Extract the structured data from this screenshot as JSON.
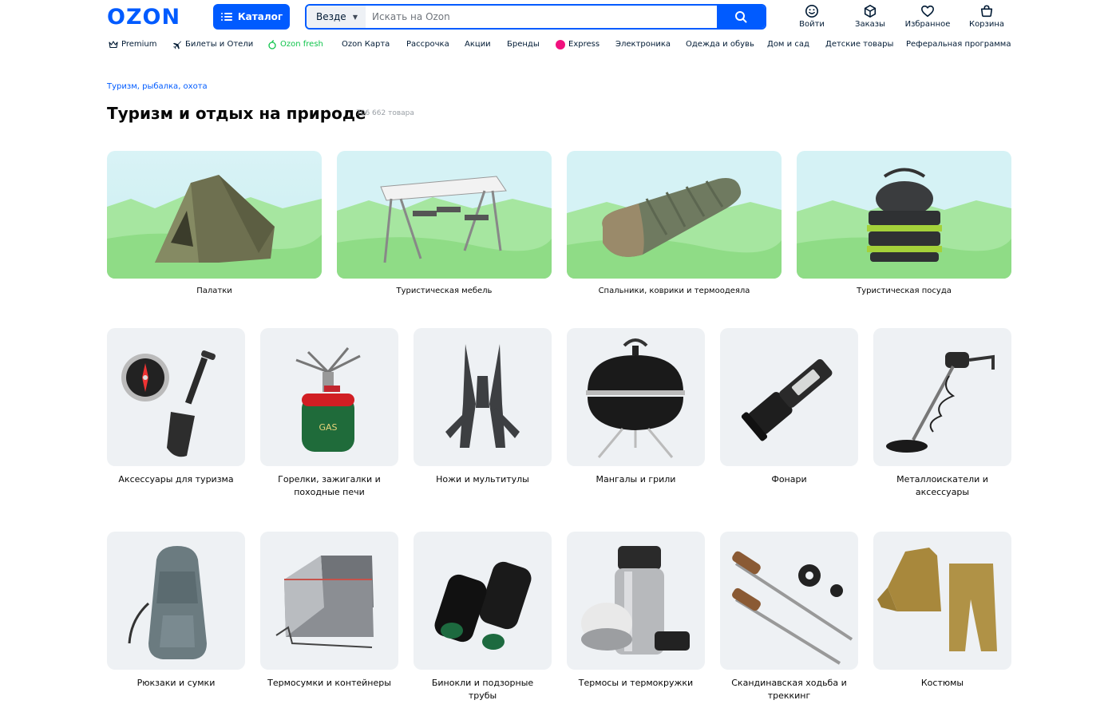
{
  "brand": {
    "logo": "OZON",
    "accent": "#005bff"
  },
  "header": {
    "catalog_label": "Каталог",
    "search_scope": "Везде",
    "search_placeholder": "Искать на Ozon",
    "actions": [
      {
        "label": "Войти",
        "icon": "user-smile-icon"
      },
      {
        "label": "Заказы",
        "icon": "box-icon"
      },
      {
        "label": "Избранное",
        "icon": "heart-icon"
      },
      {
        "label": "Корзина",
        "icon": "cart-icon"
      }
    ]
  },
  "nav": {
    "items": [
      {
        "label": "Premium",
        "icon": "crown-icon"
      },
      {
        "label": "Билеты и Отели",
        "icon": "plane-icon"
      },
      {
        "label": "Ozon fresh",
        "icon": "fresh-icon"
      },
      {
        "label": "Ozon Карта"
      },
      {
        "label": "Рассрочка"
      },
      {
        "label": "Акции"
      },
      {
        "label": "Бренды"
      },
      {
        "label": "Express",
        "icon": "express-icon"
      },
      {
        "label": "Электроника"
      },
      {
        "label": "Одежда и обувь"
      },
      {
        "label": "Дом и сад"
      },
      {
        "label": "Детские товары"
      },
      {
        "label": "Реферальная программа"
      }
    ]
  },
  "breadcrumb": "Туризм, рыбалка, охота",
  "page_title": "Туризм и отдых на природе",
  "product_count": "706 662 товара",
  "featured_categories": [
    {
      "label": "Палатки",
      "icon": "tent-image"
    },
    {
      "label": "Туристическая мебель",
      "icon": "camping-table-image"
    },
    {
      "label": "Спальники, коврики и термоодеяла",
      "icon": "sleeping-bag-image"
    },
    {
      "label": "Туристическая посуда",
      "icon": "cookware-image"
    }
  ],
  "categories_row1": [
    {
      "label": "Аксессуары для туризма",
      "icon": "compass-shovel-image"
    },
    {
      "label": "Горелки, зажигалки и походные печи",
      "icon": "gas-burner-image"
    },
    {
      "label": "Ножи и мультитулы",
      "icon": "multitool-image"
    },
    {
      "label": "Мангалы и грили",
      "icon": "grill-image"
    },
    {
      "label": "Фонари",
      "icon": "flashlight-image"
    },
    {
      "label": "Металлоискатели и аксессуары",
      "icon": "metal-detector-image"
    }
  ],
  "categories_row2": [
    {
      "label": "Рюкзаки и сумки",
      "icon": "backpack-image"
    },
    {
      "label": "Термосумки и контейнеры",
      "icon": "cooler-bag-image"
    },
    {
      "label": "Бинокли и подзорные трубы",
      "icon": "binoculars-image"
    },
    {
      "label": "Термосы и термокружки",
      "icon": "thermos-image"
    },
    {
      "label": "Скандинавская ходьба и треккинг",
      "icon": "trekking-poles-image"
    },
    {
      "label": "Костюмы",
      "icon": "suit-image"
    }
  ]
}
